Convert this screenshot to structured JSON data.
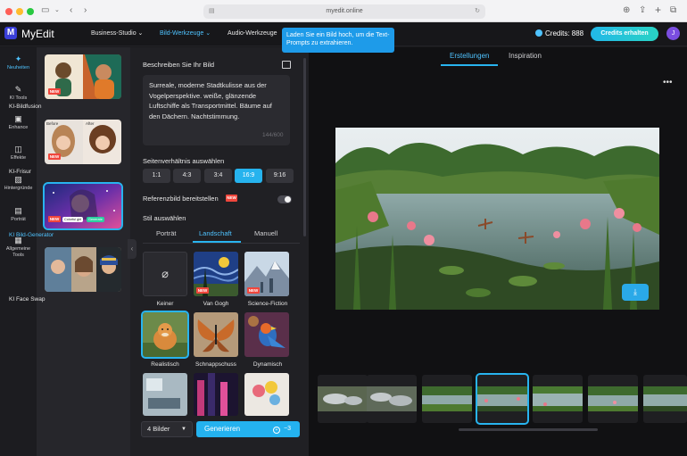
{
  "browser": {
    "url": "myedit.online",
    "colors": {
      "close": "#ff5f57",
      "minimize": "#febc2e",
      "maximize": "#28c840"
    }
  },
  "header": {
    "logo_mark": "M",
    "app_name": "MyEdit",
    "nav": [
      {
        "label": "Business-Studio ⌄"
      },
      {
        "label": "Bild-Werkzeuge ⌄"
      },
      {
        "label": "Audio-Werkzeuge"
      }
    ],
    "credits_label": "Credits: 888",
    "credits_button": "Credits erhalten",
    "avatar_initial": "J"
  },
  "tooltip": {
    "text": "Laden Sie ein Bild hoch, um die Text-Prompts zu extrahieren."
  },
  "rail": [
    {
      "icon": "✦",
      "label": "Neuheiten"
    },
    {
      "icon": "✎",
      "label": "KI Tools"
    },
    {
      "icon": "▣",
      "label": "Enhance"
    },
    {
      "icon": "◫",
      "label": "Effekte"
    },
    {
      "icon": "▨",
      "label": "Hintergründe"
    },
    {
      "icon": "▤",
      "label": "Porträt"
    },
    {
      "icon": "▦",
      "label": "Allgemeine Tools"
    }
  ],
  "tools": [
    {
      "label": "KI-Bildfusion",
      "badge": "NEW"
    },
    {
      "label": "KI-Frisur",
      "badge": "NEW",
      "before": "Before",
      "after": "After"
    },
    {
      "label": "KI Bild-Generator",
      "badge": "NEW",
      "tags": [
        "Colorful girl",
        "Generate"
      ]
    },
    {
      "label": "KI Face Swap"
    }
  ],
  "settings": {
    "describe_label": "Beschreiben Sie Ihr Bild",
    "prompt": "Surreale, moderne Stadtkulisse aus der Vogelperspektive. weiße, glänzende Luftschiffe als Transportmittel. Bäume auf den Dächern. Nachtstimmung.",
    "prompt_count": "144/600",
    "ratio_label": "Seitenverhältnis auswählen",
    "ratios": [
      "1:1",
      "4:3",
      "3:4",
      "16:9",
      "9:16"
    ],
    "ratio_selected": "16:9",
    "reference_label": "Referenzbild bereitstellen",
    "reference_badge": "NEW",
    "style_label": "Stil auswählen",
    "style_tabs": [
      "Porträt",
      "Landschaft",
      "Manuell"
    ],
    "style_tab_active": "Landschaft",
    "styles": [
      {
        "label": "Keiner",
        "icon": "⌀"
      },
      {
        "label": "Van Gogh",
        "badge": "NEW"
      },
      {
        "label": "Science-Fiction",
        "badge": "NEW"
      },
      {
        "label": "Realistisch"
      },
      {
        "label": "Schnappschuss"
      },
      {
        "label": "Dynamisch"
      }
    ],
    "image_count": "4 Bilder",
    "generate_label": "Generieren",
    "generate_cost": "−3"
  },
  "preview": {
    "tabs": [
      "Erstellungen",
      "Inspiration"
    ],
    "tab_active": "Erstellungen",
    "more_icon": "•••",
    "download_icon": "⤓"
  }
}
